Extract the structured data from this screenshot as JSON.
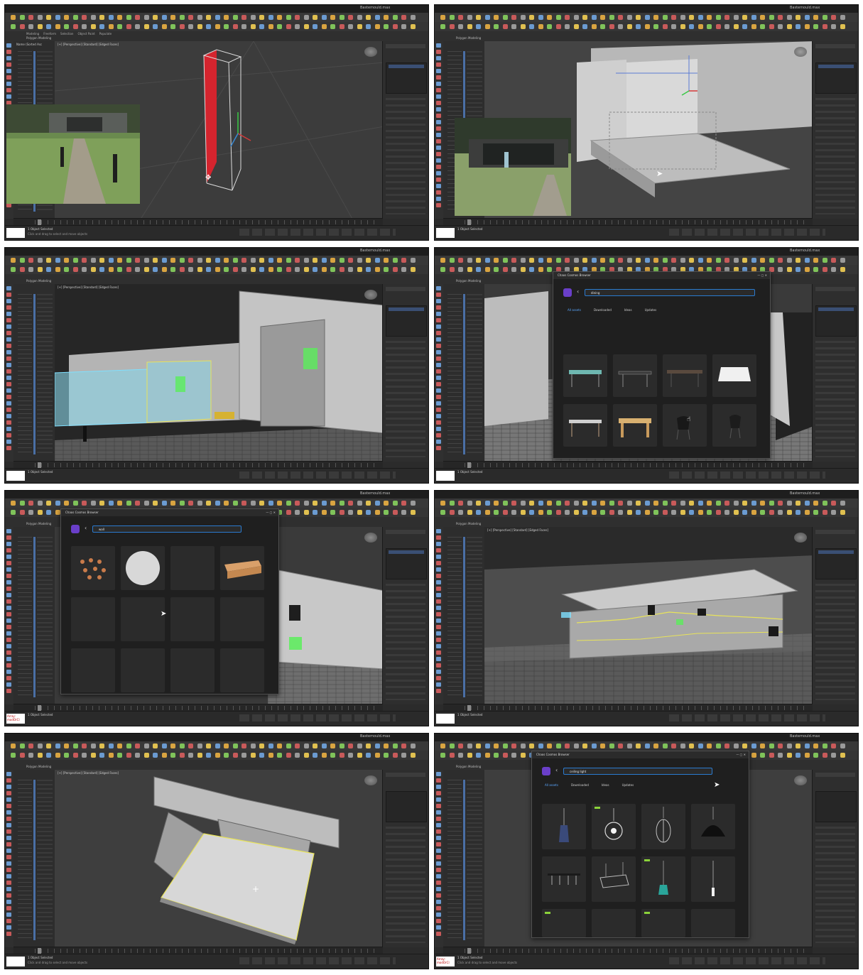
{
  "app": {
    "window_title": "Bastemould.max",
    "viewport_label": "[+] [Perspective] [Standard] [Edged Faces]",
    "ribbon_tabs": [
      "Modeling",
      "Freeform",
      "Selection",
      "Object Paint",
      "Populate"
    ],
    "ribbon_sub": "Polygon Modeling",
    "explorer_tabs": [
      "Select",
      "Display"
    ],
    "explorer_header": "Name (Sorted Asc",
    "status_selected": "1 Object Selected",
    "status_hint": "Click and drag to select and move objects",
    "listener_label": "Array: modOrCl"
  },
  "browser": {
    "title": "Chaos Cosmos Browser",
    "window_controls": "— ▢ ✕",
    "tabs": [
      "All assets",
      "Downloaded",
      "Ideas",
      "Updates"
    ]
  },
  "frames": [
    {
      "id": 1,
      "search": null
    },
    {
      "id": 2,
      "search": null
    },
    {
      "id": 3,
      "search": null
    },
    {
      "id": 4,
      "search": "dining"
    },
    {
      "id": 5,
      "search": "wall"
    },
    {
      "id": 6,
      "search": null
    },
    {
      "id": 7,
      "search": null
    },
    {
      "id": 8,
      "search": "ceiling light"
    }
  ],
  "colors": {
    "ui_dark": "#2b2b2b",
    "viewport": "#3c3c3c",
    "selection_red": "#d4242e",
    "selection_yellow": "#e8e35a",
    "cosmos_purple": "#6a3fc9",
    "accent_blue": "#2a7bd0",
    "downloaded_green": "#8bd23a"
  },
  "icons": [
    "undo-icon",
    "redo-icon",
    "link-icon",
    "select-icon",
    "move-icon",
    "rotate-icon",
    "scale-icon",
    "snap-icon",
    "render-icon",
    "teapot-icon",
    "search-icon",
    "back-icon",
    "close-icon",
    "cursor-icon"
  ]
}
